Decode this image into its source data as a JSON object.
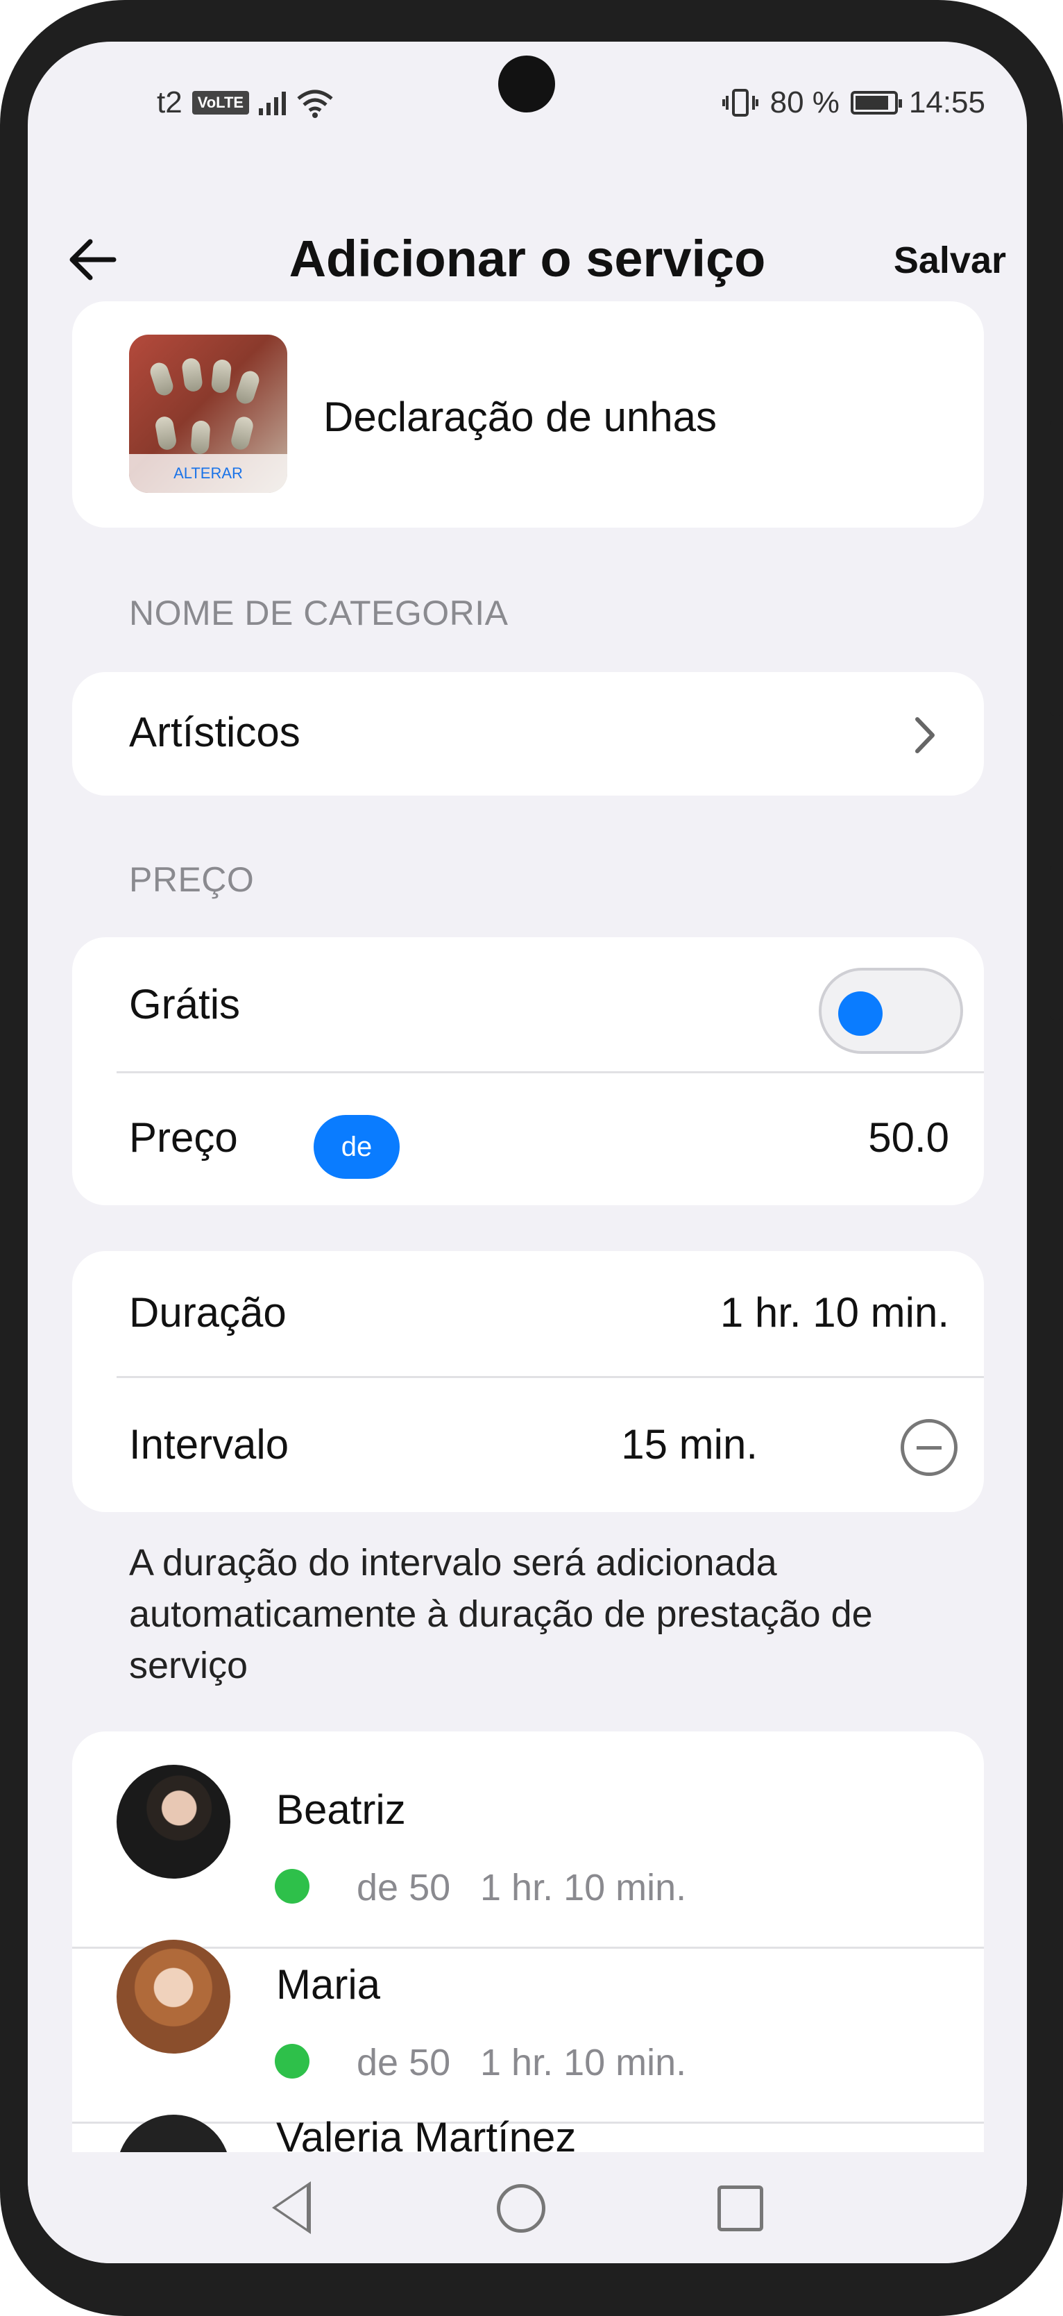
{
  "status_bar": {
    "carrier": "t2",
    "network_badge": "VoLTE",
    "battery_percent": "80 %",
    "time": "14:55",
    "icons": [
      "signal-icon",
      "wifi-icon",
      "vibrate-icon",
      "battery-icon"
    ]
  },
  "header": {
    "back_icon": "arrow-left-icon",
    "title": "Adicionar o serviço",
    "save_label": "Salvar"
  },
  "service": {
    "change_photo_label": "ALTERAR",
    "name": "Declaração de unhas"
  },
  "category": {
    "section_label": "NOME DE CATEGORIA",
    "value": "Artísticos",
    "chevron_icon": "chevron-right-icon"
  },
  "price": {
    "section_label": "PREÇO",
    "free_label": "Grátis",
    "free_toggle_on": false,
    "price_label": "Preço",
    "price_prefix": "de",
    "price_value": "50.0"
  },
  "timing": {
    "duration_label": "Duração",
    "duration_value": "1 hr. 10 min.",
    "interval_label": "Intervalo",
    "interval_value": "15 min.",
    "remove_icon": "minus-circle-icon"
  },
  "interval_note": "A duração do intervalo será adicionada automaticamente à duração de prestação de serviço",
  "staff": [
    {
      "name": "Beatriz",
      "price": "de 50",
      "duration": "1 hr. 10 min.",
      "status_color": "#2ec04a"
    },
    {
      "name": "Maria",
      "price": "de 50",
      "duration": "1 hr. 10 min.",
      "status_color": "#2ec04a"
    },
    {
      "name": "Valeria Martínez",
      "price": "",
      "duration": "",
      "status_color": "#2ec04a"
    }
  ],
  "colors": {
    "accent": "#0a7cff",
    "status_available": "#2ec04a",
    "background": "#f2f1f6"
  },
  "nav_bar": {
    "icons": [
      "nav-back-icon",
      "nav-home-icon",
      "nav-recents-icon"
    ]
  }
}
